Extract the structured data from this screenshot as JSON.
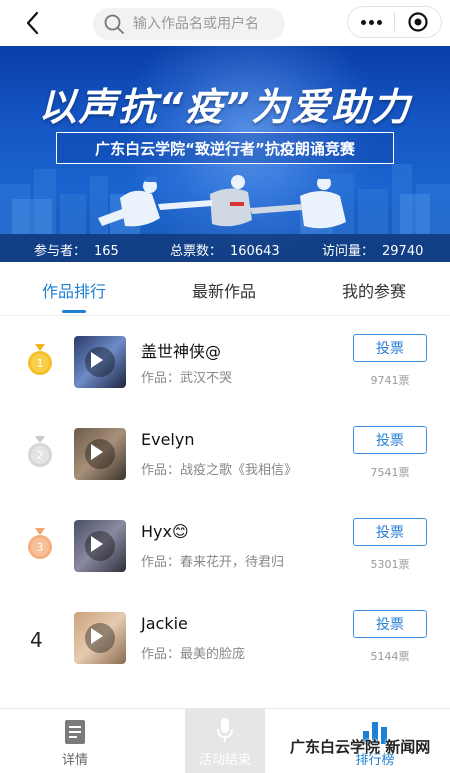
{
  "header": {
    "search_placeholder": "输入作品名或用户名",
    "icons": [
      "back-icon",
      "search-icon",
      "more-icon",
      "target-icon"
    ]
  },
  "banner": {
    "title": "以声抗“疫”为爱助力",
    "subtitle": "广东白云学院“致逆行者”抗疫朗诵竞赛",
    "stats": [
      {
        "label": "参与者：",
        "value": "165"
      },
      {
        "label": "总票数：",
        "value": "160643"
      },
      {
        "label": "访问量：",
        "value": "29740"
      }
    ]
  },
  "tabs": [
    {
      "label": "作品排行",
      "active": true
    },
    {
      "label": "最新作品",
      "active": false
    },
    {
      "label": "我的参赛",
      "active": false
    }
  ],
  "ranking": [
    {
      "rank": "1",
      "medal": "gold",
      "name": "盖世神侠@",
      "work": "作品：武汉不哭",
      "vote_label": "投票",
      "votes": "9741票"
    },
    {
      "rank": "2",
      "medal": "silver",
      "name": "Evelyn",
      "work": "作品：战疫之歌《我相信》",
      "vote_label": "投票",
      "votes": "7541票"
    },
    {
      "rank": "3",
      "medal": "bronze",
      "name": "Hyx😊",
      "work": "作品：春来花开，待君归",
      "vote_label": "投票",
      "votes": "5301票"
    },
    {
      "rank": "4",
      "medal": "",
      "name": "Jackie",
      "work": "作品：最美的脸庞",
      "vote_label": "投票",
      "votes": "5144票"
    }
  ],
  "bottom_nav": [
    {
      "label": "详情",
      "icon": "document-icon"
    },
    {
      "label": "活动结束",
      "icon": "microphone-icon"
    },
    {
      "label": "排行榜",
      "icon": "bar-chart-icon"
    }
  ],
  "watermark": "广东白云学院 新闻网",
  "colors": {
    "accent": "#1d7fd6",
    "gold": "#f3b31a",
    "silver": "#c9c9c9",
    "bronze": "#f4a26b"
  }
}
